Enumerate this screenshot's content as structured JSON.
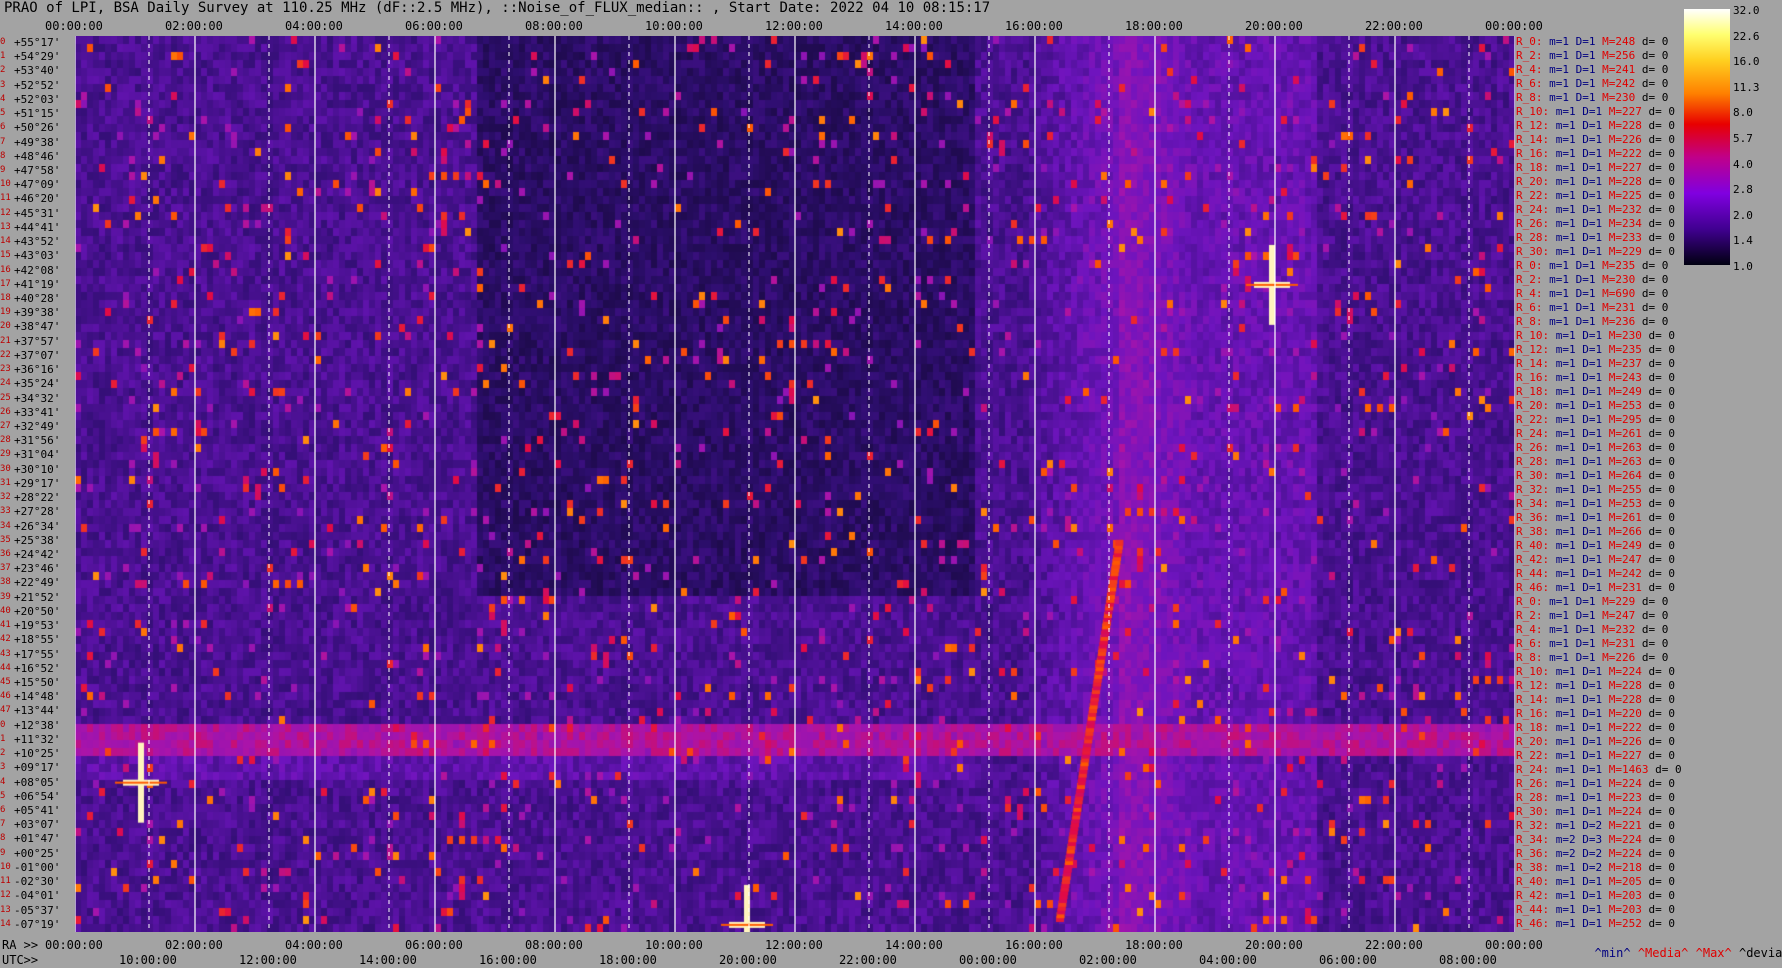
{
  "title": "PRAO of LPI, BSA Daily Survey at 110.25 MHz (dF::2.5 MHz), ::Noise_of_FLUX_median:: , Start Date: 2022 04 10 08:15:17",
  "top_ticks": [
    "00:00:00",
    "02:00:00",
    "04:00:00",
    "06:00:00",
    "08:00:00",
    "10:00:00",
    "12:00:00",
    "14:00:00",
    "16:00:00",
    "18:00:00",
    "20:00:00",
    "22:00:00",
    "00:00:00"
  ],
  "ra_ticks": [
    "00:00:00",
    "02:00:00",
    "04:00:00",
    "06:00:00",
    "08:00:00",
    "10:00:00",
    "12:00:00",
    "14:00:00",
    "16:00:00",
    "18:00:00",
    "20:00:00",
    "22:00:00",
    "00:00:00"
  ],
  "utc_ticks": [
    "10:00:00",
    "12:00:00",
    "14:00:00",
    "16:00:00",
    "18:00:00",
    "20:00:00",
    "22:00:00",
    "00:00:00",
    "02:00:00",
    "04:00:00",
    "06:00:00",
    "08:00:00"
  ],
  "ra_prefix": "RA >>",
  "utc_prefix": "UTC>>",
  "colorbar_ticks": [
    "32.0",
    "22.6",
    "16.0",
    "11.3",
    "8.0",
    "5.7",
    "4.0",
    "2.8",
    "2.0",
    "1.4",
    "1.0"
  ],
  "legend": {
    "min": "^min^",
    "median": "^Media^",
    "max": "^Max^",
    "devia": "^devia^"
  },
  "declinations": [
    "+55°17'",
    "+54°29'",
    "+53°40'",
    "+52°52'",
    "+52°03'",
    "+51°15'",
    "+50°26'",
    "+49°38'",
    "+48°46'",
    "+47°58'",
    "+47°09'",
    "+46°20'",
    "+45°31'",
    "+44°41'",
    "+43°52'",
    "+43°03'",
    "+42°08'",
    "+41°19'",
    "+40°28'",
    "+39°38'",
    "+38°47'",
    "+37°57'",
    "+37°07'",
    "+36°16'",
    "+35°24'",
    "+34°32'",
    "+33°41'",
    "+32°49'",
    "+31°56'",
    "+31°04'",
    "+30°10'",
    "+29°17'",
    "+28°22'",
    "+27°28'",
    "+26°34'",
    "+25°38'",
    "+24°42'",
    "+23°46'",
    "+22°49'",
    "+21°52'",
    "+20°50'",
    "+19°53'",
    "+18°55'",
    "+17°55'",
    "+16°52'",
    "+15°50'",
    "+14°48'",
    "+13°44'",
    "+12°38'",
    "+11°32'",
    "+10°25'",
    "+09°17'",
    "+08°05'",
    "+06°54'",
    "+05°41'",
    "+03°07'",
    "+01°47'",
    "+00°25'",
    "-01°00'",
    "-02°30'",
    "-04°01'",
    "-05°37'",
    "-07°19'"
  ],
  "right_rows": [
    {
      "r": "R_0:",
      "m": "m=1",
      "d": "D=1",
      "max": "M=248",
      "dev": "d= 0"
    },
    {
      "r": "R_2:",
      "m": "m=1",
      "d": "D=1",
      "max": "M=256",
      "dev": "d= 0"
    },
    {
      "r": "R_4:",
      "m": "m=1",
      "d": "D=1",
      "max": "M=241",
      "dev": "d= 0"
    },
    {
      "r": "R_6:",
      "m": "m=1",
      "d": "D=1",
      "max": "M=242",
      "dev": "d= 0"
    },
    {
      "r": "R_8:",
      "m": "m=1",
      "d": "D=1",
      "max": "M=230",
      "dev": "d= 0"
    },
    {
      "r": "R_10:",
      "m": "m=1",
      "d": "D=1",
      "max": "M=227",
      "dev": "d= 0"
    },
    {
      "r": "R_12:",
      "m": "m=1",
      "d": "D=1",
      "max": "M=228",
      "dev": "d= 0"
    },
    {
      "r": "R_14:",
      "m": "m=1",
      "d": "D=1",
      "max": "M=226",
      "dev": "d= 0"
    },
    {
      "r": "R_16:",
      "m": "m=1",
      "d": "D=1",
      "max": "M=222",
      "dev": "d= 0"
    },
    {
      "r": "R_18:",
      "m": "m=1",
      "d": "D=1",
      "max": "M=227",
      "dev": "d= 0"
    },
    {
      "r": "R_20:",
      "m": "m=1",
      "d": "D=1",
      "max": "M=228",
      "dev": "d= 0"
    },
    {
      "r": "R_22:",
      "m": "m=1",
      "d": "D=1",
      "max": "M=225",
      "dev": "d= 0"
    },
    {
      "r": "R_24:",
      "m": "m=1",
      "d": "D=1",
      "max": "M=232",
      "dev": "d= 0"
    },
    {
      "r": "R_26:",
      "m": "m=1",
      "d": "D=1",
      "max": "M=234",
      "dev": "d= 0"
    },
    {
      "r": "R_28:",
      "m": "m=1",
      "d": "D=1",
      "max": "M=233",
      "dev": "d= 0"
    },
    {
      "r": "R_30:",
      "m": "m=1",
      "d": "D=1",
      "max": "M=229",
      "dev": "d= 0"
    },
    {
      "r": "R_0:",
      "m": "m=1",
      "d": "D=1",
      "max": "M=235",
      "dev": "d= 0"
    },
    {
      "r": "R_2:",
      "m": "m=1",
      "d": "D=1",
      "max": "M=230",
      "dev": "d= 0"
    },
    {
      "r": "R_4:",
      "m": "m=1",
      "d": "D=1",
      "max": "M=690",
      "dev": "d= 0"
    },
    {
      "r": "R_6:",
      "m": "m=1",
      "d": "D=1",
      "max": "M=231",
      "dev": "d= 0"
    },
    {
      "r": "R_8:",
      "m": "m=1",
      "d": "D=1",
      "max": "M=236",
      "dev": "d= 0"
    },
    {
      "r": "R_10:",
      "m": "m=1",
      "d": "D=1",
      "max": "M=230",
      "dev": "d= 0"
    },
    {
      "r": "R_12:",
      "m": "m=1",
      "d": "D=1",
      "max": "M=235",
      "dev": "d= 0"
    },
    {
      "r": "R_14:",
      "m": "m=1",
      "d": "D=1",
      "max": "M=237",
      "dev": "d= 0"
    },
    {
      "r": "R_16:",
      "m": "m=1",
      "d": "D=1",
      "max": "M=243",
      "dev": "d= 0"
    },
    {
      "r": "R_18:",
      "m": "m=1",
      "d": "D=1",
      "max": "M=249",
      "dev": "d= 0"
    },
    {
      "r": "R_20:",
      "m": "m=1",
      "d": "D=1",
      "max": "M=253",
      "dev": "d= 0"
    },
    {
      "r": "R_22:",
      "m": "m=1",
      "d": "D=1",
      "max": "M=295",
      "dev": "d= 0"
    },
    {
      "r": "R_24:",
      "m": "m=1",
      "d": "D=1",
      "max": "M=261",
      "dev": "d= 0"
    },
    {
      "r": "R_26:",
      "m": "m=1",
      "d": "D=1",
      "max": "M=263",
      "dev": "d= 0"
    },
    {
      "r": "R_28:",
      "m": "m=1",
      "d": "D=1",
      "max": "M=263",
      "dev": "d= 0"
    },
    {
      "r": "R_30:",
      "m": "m=1",
      "d": "D=1",
      "max": "M=264",
      "dev": "d= 0"
    },
    {
      "r": "R_32:",
      "m": "m=1",
      "d": "D=1",
      "max": "M=255",
      "dev": "d= 0"
    },
    {
      "r": "R_34:",
      "m": "m=1",
      "d": "D=1",
      "max": "M=253",
      "dev": "d= 0"
    },
    {
      "r": "R_36:",
      "m": "m=1",
      "d": "D=1",
      "max": "M=261",
      "dev": "d= 0"
    },
    {
      "r": "R_38:",
      "m": "m=1",
      "d": "D=1",
      "max": "M=266",
      "dev": "d= 0"
    },
    {
      "r": "R_40:",
      "m": "m=1",
      "d": "D=1",
      "max": "M=249",
      "dev": "d= 0"
    },
    {
      "r": "R_42:",
      "m": "m=1",
      "d": "D=1",
      "max": "M=247",
      "dev": "d= 0"
    },
    {
      "r": "R_44:",
      "m": "m=1",
      "d": "D=1",
      "max": "M=242",
      "dev": "d= 0"
    },
    {
      "r": "R_46:",
      "m": "m=1",
      "d": "D=1",
      "max": "M=231",
      "dev": "d= 0"
    },
    {
      "r": "R_0:",
      "m": "m=1",
      "d": "D=1",
      "max": "M=229",
      "dev": "d= 0"
    },
    {
      "r": "R_2:",
      "m": "m=1",
      "d": "D=1",
      "max": "M=247",
      "dev": "d= 0"
    },
    {
      "r": "R_4:",
      "m": "m=1",
      "d": "D=1",
      "max": "M=232",
      "dev": "d= 0"
    },
    {
      "r": "R_6:",
      "m": "m=1",
      "d": "D=1",
      "max": "M=231",
      "dev": "d= 0"
    },
    {
      "r": "R_8:",
      "m": "m=1",
      "d": "D=1",
      "max": "M=226",
      "dev": "d= 0"
    },
    {
      "r": "R_10:",
      "m": "m=1",
      "d": "D=1",
      "max": "M=224",
      "dev": "d= 0"
    },
    {
      "r": "R_12:",
      "m": "m=1",
      "d": "D=1",
      "max": "M=228",
      "dev": "d= 0"
    },
    {
      "r": "R_14:",
      "m": "m=1",
      "d": "D=1",
      "max": "M=228",
      "dev": "d= 0"
    },
    {
      "r": "R_16:",
      "m": "m=1",
      "d": "D=1",
      "max": "M=220",
      "dev": "d= 0"
    },
    {
      "r": "R_18:",
      "m": "m=1",
      "d": "D=1",
      "max": "M=222",
      "dev": "d= 0"
    },
    {
      "r": "R_20:",
      "m": "m=1",
      "d": "D=1",
      "max": "M=226",
      "dev": "d= 0"
    },
    {
      "r": "R_22:",
      "m": "m=1",
      "d": "D=1",
      "max": "M=227",
      "dev": "d= 0"
    },
    {
      "r": "R_24:",
      "m": "m=1",
      "d": "D=1",
      "max": "M=1463",
      "dev": "d= 0"
    },
    {
      "r": "R_26:",
      "m": "m=1",
      "d": "D=1",
      "max": "M=224",
      "dev": "d= 0"
    },
    {
      "r": "R_28:",
      "m": "m=1",
      "d": "D=1",
      "max": "M=223",
      "dev": "d= 0"
    },
    {
      "r": "R_30:",
      "m": "m=1",
      "d": "D=1",
      "max": "M=224",
      "dev": "d= 0"
    },
    {
      "r": "R_32:",
      "m": "m=1",
      "d": "D=2",
      "max": "M=221",
      "dev": "d= 0"
    },
    {
      "r": "R_34:",
      "m": "m=2",
      "d": "D=3",
      "max": "M=224",
      "dev": "d= 0"
    },
    {
      "r": "R_36:",
      "m": "m=2",
      "d": "D=2",
      "max": "M=224",
      "dev": "d= 0"
    },
    {
      "r": "R_38:",
      "m": "m=1",
      "d": "D=2",
      "max": "M=218",
      "dev": "d= 0"
    },
    {
      "r": "R_40:",
      "m": "m=1",
      "d": "D=1",
      "max": "M=205",
      "dev": "d= 0"
    },
    {
      "r": "R_42:",
      "m": "m=1",
      "d": "D=1",
      "max": "M=203",
      "dev": "d= 0"
    },
    {
      "r": "R_44:",
      "m": "m=1",
      "d": "D=1",
      "max": "M=203",
      "dev": "d= 0"
    },
    {
      "r": "R_46:",
      "m": "m=1",
      "d": "D=1",
      "max": "M=252",
      "dev": "d= 0"
    }
  ],
  "chart_data": {
    "type": "heatmap",
    "title": "PRAO of LPI, BSA Daily Survey at 110.25 MHz (dF::2.5 MHz), ::Noise_of_FLUX_median:: , Start Date: 2022 04 10 08:15:17",
    "x_axis": "RA 00:00:00 to 24:00:00 (UTC 08:15 to 08:15 next day)",
    "y_axis": "Declination +55°17' to -07°19'",
    "colorbar": [
      32.0,
      22.6,
      16.0,
      11.3,
      8.0,
      5.7,
      4.0,
      2.8,
      2.0,
      1.4,
      1.0
    ],
    "sources": [
      {
        "ra_h": 1.1,
        "dec": "+08°05'",
        "note": "bright"
      },
      {
        "ra_h": 19.95,
        "dec": "+41°19'",
        "note": "bright"
      },
      {
        "ra_h": 11.2,
        "dec": "-07°19'",
        "note": "bright"
      }
    ]
  }
}
